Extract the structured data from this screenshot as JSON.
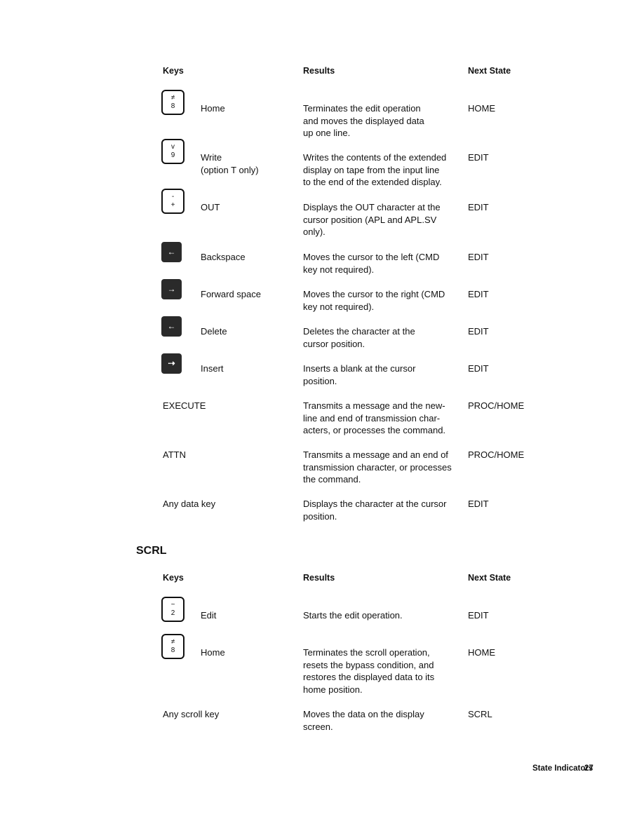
{
  "table1": {
    "headers": {
      "keys": "Keys",
      "results": "Results",
      "next": "Next State"
    },
    "rows": [
      {
        "key_top": "≠",
        "key_bottom": "8",
        "key_style": "outline",
        "label": "Home",
        "result": "Terminates the edit operation\nand moves the displayed data\nup one line.",
        "next": "HOME"
      },
      {
        "key_top": "v",
        "key_bottom": "9",
        "key_style": "outline",
        "label": "Write\n(option T only)",
        "result": "Writes the contents of the extended\ndisplay on tape from the input line\nto the end of the extended display.",
        "next": "EDIT"
      },
      {
        "key_top": "-",
        "key_bottom": "+",
        "key_style": "outline",
        "label": "OUT",
        "result": "Displays the OUT character at the\ncursor position (APL and APL.SV\nonly).",
        "next": "EDIT"
      },
      {
        "key_glyph": "←",
        "key_style": "dark",
        "label": "Backspace",
        "result": "Moves the cursor to the left (CMD\nkey not required).",
        "next": "EDIT"
      },
      {
        "key_glyph": "→",
        "key_style": "dark",
        "label": "Forward space",
        "result": "Moves the cursor to the right (CMD\nkey not required).",
        "next": "EDIT"
      },
      {
        "key_glyph": "←",
        "key_style": "dark",
        "label": "Delete",
        "result": "Deletes the character at the\ncursor position.",
        "next": "EDIT"
      },
      {
        "key_glyph": "⇢",
        "key_style": "dark",
        "label": "Insert",
        "result": "Inserts a blank at the cursor\nposition.",
        "next": "EDIT"
      },
      {
        "label": "EXECUTE",
        "result": "Transmits a message and the new-\nline and end of transmission char-\nacters, or processes the command.",
        "next": "PROC/HOME"
      },
      {
        "label": "ATTN",
        "result": "Transmits a message and an end of\ntransmission character, or processes\nthe command.",
        "next": "PROC/HOME"
      },
      {
        "label": "Any data key",
        "result": "Displays the character at the cursor\nposition.",
        "next": "EDIT"
      }
    ]
  },
  "section_title": "SCRL",
  "table2": {
    "headers": {
      "keys": "Keys",
      "results": "Results",
      "next": "Next State"
    },
    "rows": [
      {
        "key_top": "~",
        "key_bottom": "2",
        "key_style": "outline",
        "label": "Edit",
        "result": "Starts the edit operation.",
        "next": "EDIT"
      },
      {
        "key_top": "≠",
        "key_bottom": "8",
        "key_style": "outline",
        "label": "Home",
        "result": "Terminates the scroll operation,\nresets the bypass condition, and\nrestores the displayed data to its\nhome position.",
        "next": "HOME"
      },
      {
        "label": "Any scroll key",
        "result": "Moves the data on the display\nscreen.",
        "next": "SCRL"
      }
    ]
  },
  "footer": {
    "title": "State Indicators",
    "page": "27"
  }
}
